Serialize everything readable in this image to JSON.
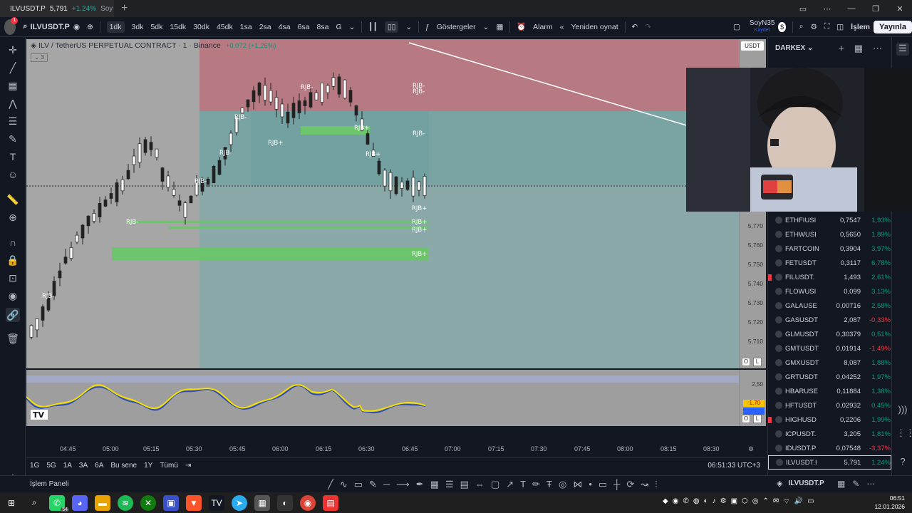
{
  "browser": {
    "tab_symbol": "ILVUSDT.P",
    "tab_price": "5,791",
    "tab_change": "+1.24%",
    "tab_rest": "Soy",
    "close": "×",
    "new_tab": "+"
  },
  "toolbar": {
    "symbol": "ILVUSDT.P",
    "intervals": [
      "1dk",
      "3dk",
      "5dk",
      "15dk",
      "30dk",
      "45dk",
      "1sa",
      "2sa",
      "4sa",
      "6sa",
      "8sa",
      "G"
    ],
    "indicators_label": "Göstergeler",
    "alarm_label": "Alarm",
    "replay_label": "Yeniden oynat",
    "user_name": "SoyN35",
    "user_sub": "Kaydet",
    "islem_label": "İşlem",
    "publish_label": "Yayınla"
  },
  "chart": {
    "legend_title": "ILV / TetherUS PERPETUAL CONTRACT · 1 · Binance",
    "legend_change": "+0,072 (+1,26%)",
    "legend_count": "3",
    "currency": "USDT",
    "price_labels": [
      "5,770",
      "5,760",
      "5,750",
      "5,740",
      "5,730",
      "5,720",
      "5,710"
    ],
    "rjb_labels": [
      {
        "text": "RJB-"
      },
      {
        "text": "RJB-"
      },
      {
        "text": "RJB-"
      },
      {
        "text": "RJB-"
      },
      {
        "text": "RJB-"
      },
      {
        "text": "RJB-"
      },
      {
        "text": "RJB-"
      },
      {
        "text": "RJB-"
      },
      {
        "text": "RJB+"
      },
      {
        "text": "RJB+"
      },
      {
        "text": "RJB+"
      },
      {
        "text": "RJB+"
      },
      {
        "text": "RJB+"
      },
      {
        "text": "RJB+"
      },
      {
        "text": "RJB+"
      },
      {
        "text": "RJB-"
      }
    ],
    "ol_o": "O",
    "ol_l": "L"
  },
  "oscillator": {
    "labels": [
      "2,50",
      "-1,70"
    ],
    "ol_o": "O",
    "ol_l": "L"
  },
  "time_axis": [
    "04:45",
    "05:00",
    "05:15",
    "05:30",
    "05:45",
    "06:00",
    "06:15",
    "06:30",
    "06:45",
    "07:00",
    "07:15",
    "07:30",
    "07:45",
    "08:00",
    "08:15",
    "08:30"
  ],
  "ranges": [
    "1G",
    "5G",
    "1A",
    "3A",
    "6A",
    "Bu sene",
    "1Y",
    "Tümü"
  ],
  "clock": "06:51:33 UTC+3",
  "panel_title": "İşlem Paneli",
  "watchlist": {
    "title": "DARKEX",
    "bottom_symbol": "ILVUSDT.P",
    "rows": [
      {
        "sym": "ETHFIUSI",
        "last": "0,7547",
        "chg": "1,93%",
        "dir": "up",
        "flag": false,
        "selected": false
      },
      {
        "sym": "ETHWUSI",
        "last": "0,5650",
        "chg": "1,89%",
        "dir": "up",
        "flag": false,
        "selected": false
      },
      {
        "sym": "FARTCOIN",
        "last": "0,3904",
        "chg": "3,97%",
        "dir": "up",
        "flag": false,
        "selected": false
      },
      {
        "sym": "FETUSDT",
        "last": "0,3117",
        "chg": "6,78%",
        "dir": "up",
        "flag": false,
        "selected": false
      },
      {
        "sym": "FILUSDT.",
        "last": "1,493",
        "chg": "2,61%",
        "dir": "up",
        "flag": true,
        "selected": false
      },
      {
        "sym": "FLOWUSI",
        "last": "0,099",
        "chg": "3,13%",
        "dir": "up",
        "flag": false,
        "selected": false
      },
      {
        "sym": "GALAUSE",
        "last": "0,00716",
        "chg": "2,58%",
        "dir": "up",
        "flag": false,
        "selected": false
      },
      {
        "sym": "GASUSDT",
        "last": "2,087",
        "chg": "-0,33%",
        "dir": "dn",
        "flag": false,
        "selected": false
      },
      {
        "sym": "GLMUSDT",
        "last": "0,30379",
        "chg": "0,51%",
        "dir": "up",
        "flag": false,
        "selected": false
      },
      {
        "sym": "GMTUSDT",
        "last": "0,01914",
        "chg": "-1,49%",
        "dir": "dn",
        "flag": false,
        "selected": false
      },
      {
        "sym": "GMXUSDT",
        "last": "8,087",
        "chg": "1,88%",
        "dir": "up",
        "flag": false,
        "selected": false
      },
      {
        "sym": "GRTUSDT",
        "last": "0,04252",
        "chg": "1,97%",
        "dir": "up",
        "flag": false,
        "selected": false
      },
      {
        "sym": "HBARUSE",
        "last": "0,11884",
        "chg": "1,38%",
        "dir": "up",
        "flag": false,
        "selected": false
      },
      {
        "sym": "HFTUSDT",
        "last": "0,02932",
        "chg": "0,45%",
        "dir": "up",
        "flag": false,
        "selected": false
      },
      {
        "sym": "HIGHUSD",
        "last": "0,2206",
        "chg": "1,99%",
        "dir": "up",
        "flag": true,
        "selected": false
      },
      {
        "sym": "ICPUSDT.",
        "last": "3,205",
        "chg": "1,81%",
        "dir": "up",
        "flag": false,
        "selected": false
      },
      {
        "sym": "IDUSDT.P",
        "last": "0,07548",
        "chg": "-3,37%",
        "dir": "dn",
        "flag": false,
        "selected": false
      },
      {
        "sym": "ILVUSDT.I",
        "last": "5,791",
        "chg": "1,24%",
        "dir": "up",
        "flag": false,
        "selected": true
      }
    ]
  },
  "taskbar": {
    "whatsapp_badge": "54",
    "time": "06:51",
    "date": "12.01.2026"
  },
  "colors": {
    "up": "#089981",
    "down": "#f23645",
    "chart_bg": "#9e9e9e",
    "red_zone": "#b87a82",
    "teal_zone": "#7aa3a3",
    "green_zone": "#6cc46c"
  }
}
